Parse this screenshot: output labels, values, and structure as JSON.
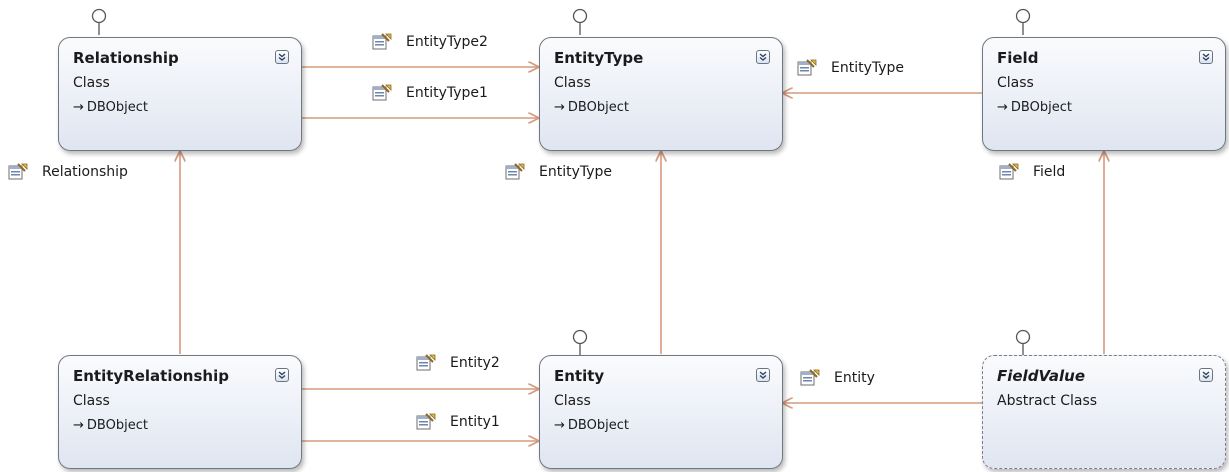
{
  "classes": {
    "relationship": {
      "title": "Relationship",
      "kind": "Class",
      "base": "DBObject"
    },
    "entity_type": {
      "title": "EntityType",
      "kind": "Class",
      "base": "DBObject"
    },
    "field": {
      "title": "Field",
      "kind": "Class",
      "base": "DBObject"
    },
    "entity_relationship": {
      "title": "EntityRelationship",
      "kind": "Class",
      "base": "DBObject"
    },
    "entity": {
      "title": "Entity",
      "kind": "Class",
      "base": "DBObject"
    },
    "field_value": {
      "title": "FieldValue",
      "kind": "Abstract Class"
    }
  },
  "associations": {
    "entity_type2": "EntityType2",
    "entity_type1": "EntityType1",
    "field_entity_type": "EntityType",
    "relationship": "Relationship",
    "entity_entity_type": "EntityType",
    "field": "Field",
    "entity2": "Entity2",
    "entity1": "Entity1",
    "field_value_entity": "Entity"
  },
  "icons": {
    "expand": "double-chevron-down-icon",
    "property": "property-icon",
    "interface": "lollipop-interface-icon",
    "inherits": "inheritance-arrow-icon"
  },
  "colors": {
    "connector": "#d69a7f",
    "node_border": "#6f7780",
    "node_gradient_top": "#fafbfd",
    "node_gradient_bottom": "#dfe5f1"
  }
}
